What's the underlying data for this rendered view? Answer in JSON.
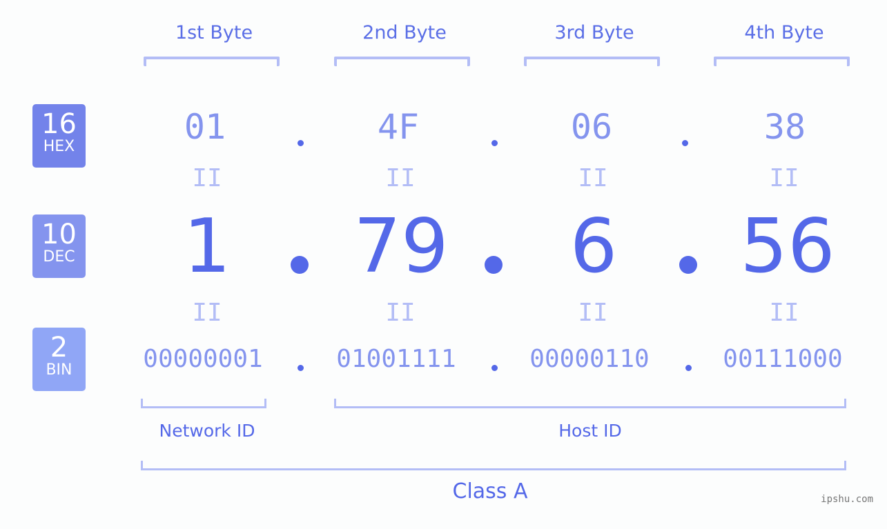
{
  "bytes": {
    "headers": [
      "1st Byte",
      "2nd Byte",
      "3rd Byte",
      "4th Byte"
    ]
  },
  "badges": {
    "hex": {
      "num": "16",
      "label": "HEX",
      "color": "#7383ea"
    },
    "dec": {
      "num": "10",
      "label": "DEC",
      "color": "#8494ee"
    },
    "bin": {
      "num": "2",
      "label": "BIN",
      "color": "#90a6f6"
    }
  },
  "hex_values": [
    "01",
    "4F",
    "06",
    "38"
  ],
  "dec_values": [
    "1",
    "79",
    "6",
    "56"
  ],
  "bin_values": [
    "00000001",
    "01001111",
    "00000110",
    "00111000"
  ],
  "equals_sign": "II",
  "labels": {
    "network_id": "Network ID",
    "host_id": "Host ID",
    "class": "Class A"
  },
  "watermark": "ipshu.com",
  "colors": {
    "accent": "#5468e8",
    "light": "#b3bdf6",
    "mid": "#8494ee"
  }
}
